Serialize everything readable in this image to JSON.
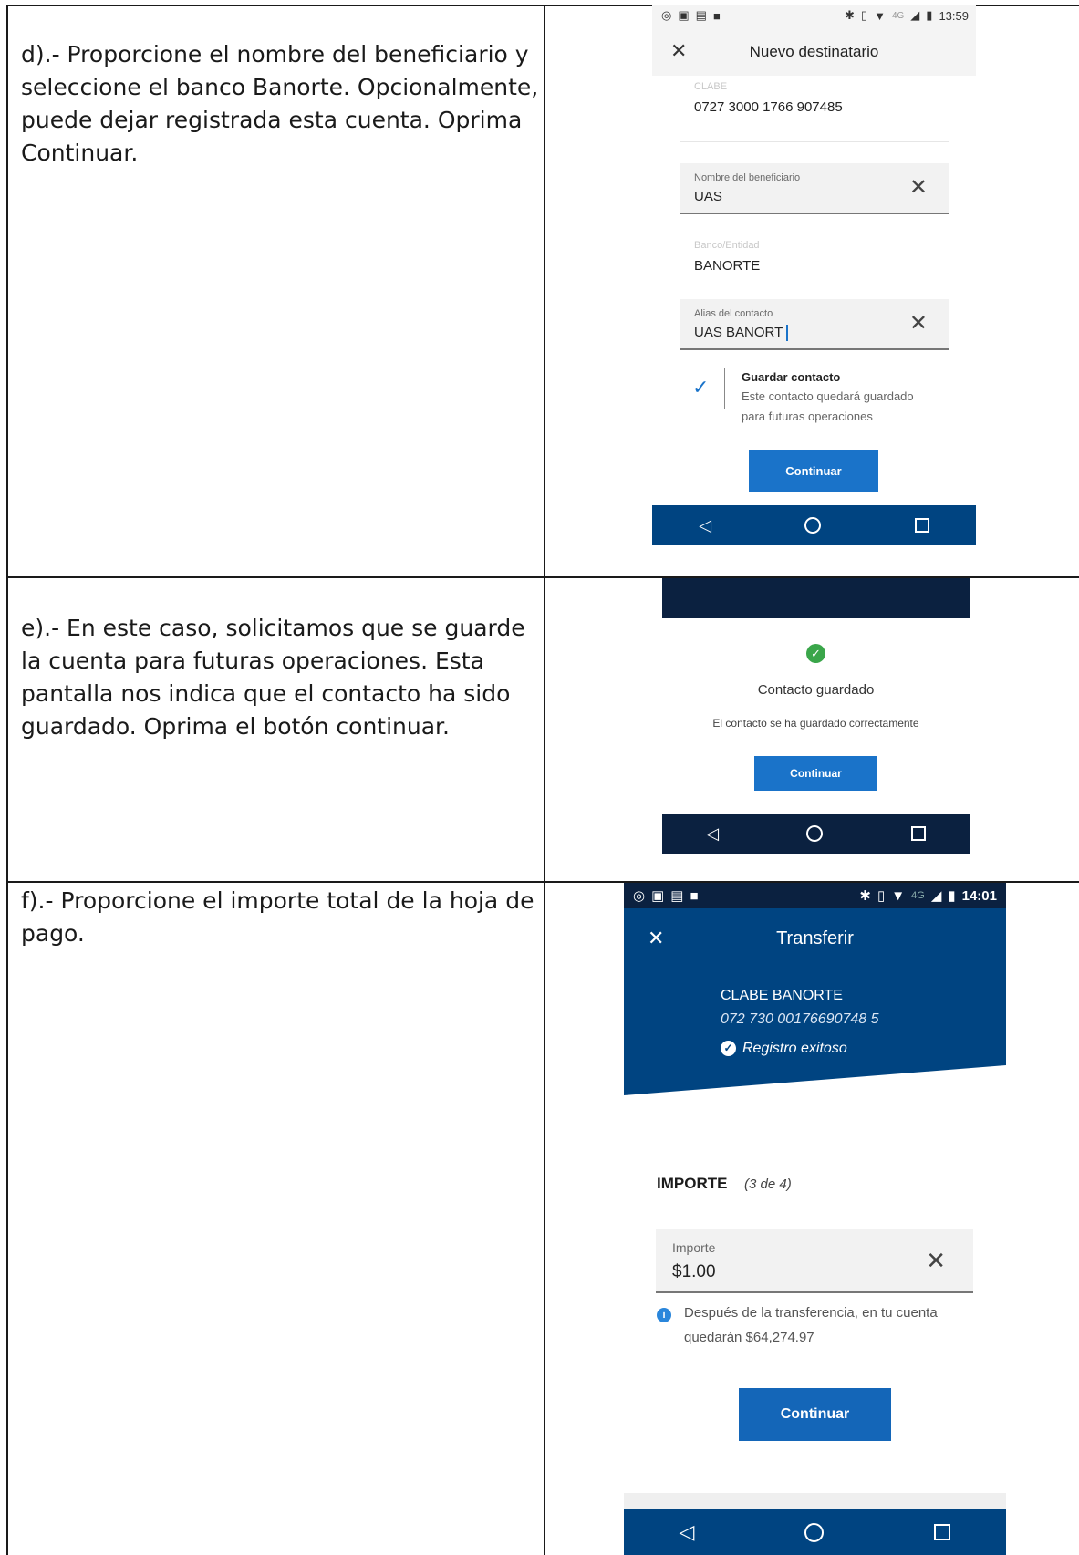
{
  "rows": [
    {
      "instruction": "d).- Proporcione el nombre del beneficiario y seleccione el banco Banorte. Opcionalmente, puede dejar registrada esta cuenta. Oprima Continuar.",
      "phone": {
        "status_time": "13:59",
        "network": "4G",
        "screen_title": "Nuevo destinatario",
        "clabe_label": "CLABE",
        "clabe_value": "0727 3000 1766 907485",
        "name_label": "Nombre del beneficiario",
        "name_value": "UAS",
        "bank_label": "Banco/Entidad",
        "bank_value": "BANORTE",
        "alias_label": "Alias del contacto",
        "alias_value": "UAS BANORT",
        "save_title": "Guardar contacto",
        "save_desc_1": "Este contacto quedará guardado",
        "save_desc_2": "para futuras operaciones",
        "save_checked": true,
        "continue_label": "Continuar"
      }
    },
    {
      "instruction": "e).- En este caso, solicitamos que se guarde la cuenta para futuras operaciones. Esta pantalla nos indica que el contacto ha sido guardado. Oprima el botón continuar.",
      "phone": {
        "success_title": "Contacto guardado",
        "success_desc": "El contacto se ha guardado correctamente",
        "continue_label": "Continuar"
      }
    },
    {
      "instruction": "f).- Proporcione el importe total de la hoja de pago.",
      "phone": {
        "status_time": "14:01",
        "network": "4G",
        "screen_title": "Transferir",
        "account_title": "CLABE BANORTE",
        "account_number": "072 730 00176690748 5",
        "registro": "Registro exitoso",
        "section_title": "IMPORTE",
        "section_step": "(3 de 4)",
        "amount_label": "Importe",
        "amount_value": "$1.00",
        "info_1": "Después de la transferencia, en tu cuenta",
        "info_2": "quedarán $64,274.97",
        "continue_label": "Continuar"
      }
    }
  ],
  "colors": {
    "bbva_blue": "#004481",
    "navy": "#0b2140",
    "button_blue": "#1a73c9",
    "success_green": "#3aa64a"
  }
}
